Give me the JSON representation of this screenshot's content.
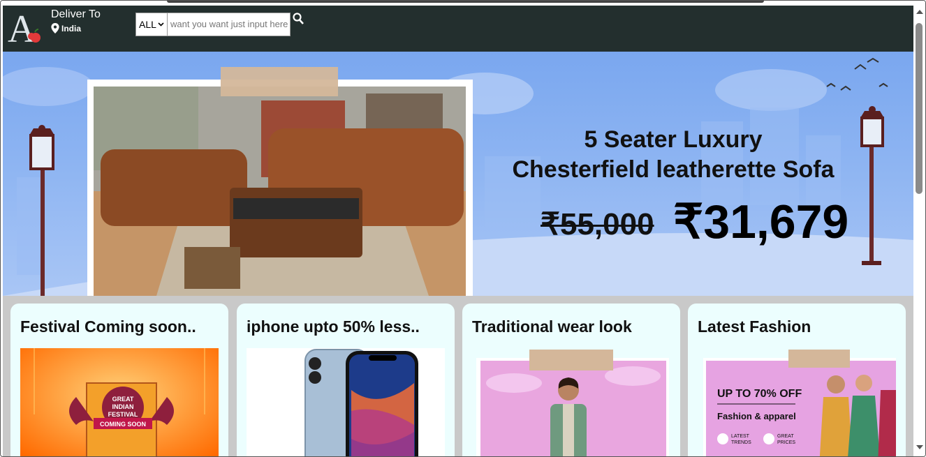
{
  "header": {
    "deliver_to": "Deliver To",
    "location": "India",
    "category_selected": "ALL",
    "search_placeholder": "want you want just input here"
  },
  "hero": {
    "title_line1": "5 Seater Luxury",
    "title_line2": "Chesterfield leatherette Sofa",
    "old_price": "₹55,000",
    "new_price": "₹31,679"
  },
  "cards": [
    {
      "title": "Festival Coming soon..",
      "image": "great-indian-festival-banner"
    },
    {
      "title": "iphone upto 50% less..",
      "image": "iphone-product-image"
    },
    {
      "title": "Traditional wear look",
      "image": "traditional-wear-model"
    },
    {
      "title": "Latest Fashion",
      "image": "fashion-sale-banner"
    }
  ],
  "fest_banner": {
    "line1": "GREAT",
    "line2": "INDIAN",
    "line3": "FESTIVAL",
    "ribbon": "COMING SOON"
  },
  "fashion_banner": {
    "headline": "UP TO 70% OFF",
    "sub": "Fashion & apparel",
    "tag1a": "LATEST",
    "tag1b": "TRENDS",
    "tag2a": "GREAT",
    "tag2b": "PRICES"
  },
  "colors": {
    "nav_bg": "#232f2e",
    "hero_bg": "#8db4f2",
    "card_bg": "#ecfefe",
    "cards_bg": "#c9c9c9"
  }
}
